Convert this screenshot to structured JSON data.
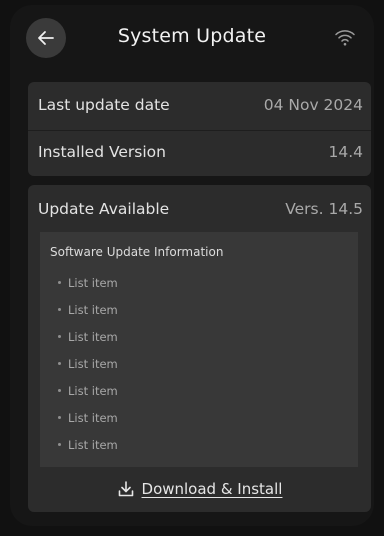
{
  "header": {
    "title": "System Update",
    "back_icon": "arrow-left-icon",
    "status_icon": "wifi-icon"
  },
  "current": {
    "last_update_label": "Last update date",
    "last_update_value": "04 Nov 2024",
    "installed_label": "Installed Version",
    "installed_value": "14.4"
  },
  "update": {
    "available_label": "Update Available",
    "available_value": "Vers. 14.5",
    "info_title": "Software Update Information",
    "items": [
      "List item",
      "List item",
      "List item",
      "List item",
      "List item",
      "List item",
      "List item"
    ],
    "download_label": "Download & Install",
    "download_icon": "download-icon"
  },
  "colors": {
    "background": "#161616",
    "card": "#2c2c2c",
    "info_box": "#383838",
    "back_button": "#3a3a3a"
  }
}
